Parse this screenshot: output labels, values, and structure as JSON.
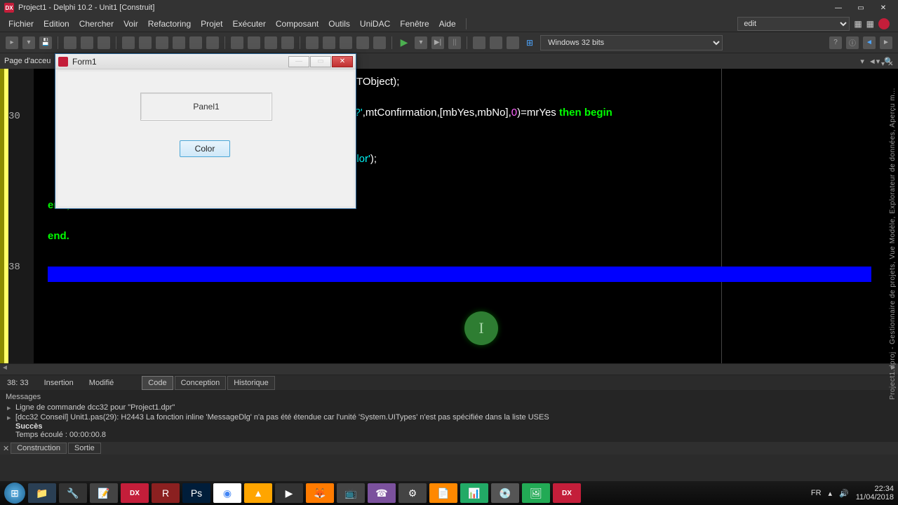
{
  "titlebar": {
    "title": "Project1 - Delphi 10.2 - Unit1 [Construit]"
  },
  "menu": {
    "items": [
      "Fichier",
      "Edition",
      "Chercher",
      "Voir",
      "Refactoring",
      "Projet",
      "Exécuter",
      "Composant",
      "Outils",
      "UniDAC",
      "Fenêtre",
      "Aide"
    ],
    "edit_box": "edit"
  },
  "toolbar": {
    "platform": "Windows 32 bits"
  },
  "tabs": {
    "active": "Page d'acceu"
  },
  "gutter": {
    "l30": "30",
    "l38": "38"
  },
  "code": {
    "l1a": "TObject);",
    "l2a": "l ?'",
    "l2b": ",mtConfirmation,[mbYes,mbNo],",
    "l2c": "0",
    "l2d": ")=mrYes ",
    "l2e": "then begin",
    "l3a": "olor'",
    "l3b": ");",
    "l4": "end;",
    "l5": "end."
  },
  "status": {
    "pos": "38: 33",
    "mode": "Insertion",
    "mod": "Modifié",
    "tab_code": "Code",
    "tab_conception": "Conception",
    "tab_hist": "Historique"
  },
  "messages": {
    "title": "Messages",
    "r1": "Ligne de commande dcc32 pour \"Project1.dpr\"",
    "r2": "[dcc32 Conseil] Unit1.pas(29): H2443 La fonction inline 'MessageDlg' n'a pas été étendue car l'unité 'System.UITypes' n'est pas spécifiée dans la liste USES",
    "ok": "Succès",
    "elapsed": "Temps écoulé :  00:00:00.8"
  },
  "bottom_tabs": {
    "construction": "Construction",
    "sortie": "Sortie"
  },
  "side_text": "Project1.dproj - Gestionnaire de projets, Vue Modèle, Explorateur de données, Aperçu m...",
  "form1": {
    "title": "Form1",
    "panel": "Panel1",
    "button": "Color"
  },
  "tray": {
    "lang": "FR",
    "time": "22:34",
    "date": "11/04/2018"
  }
}
